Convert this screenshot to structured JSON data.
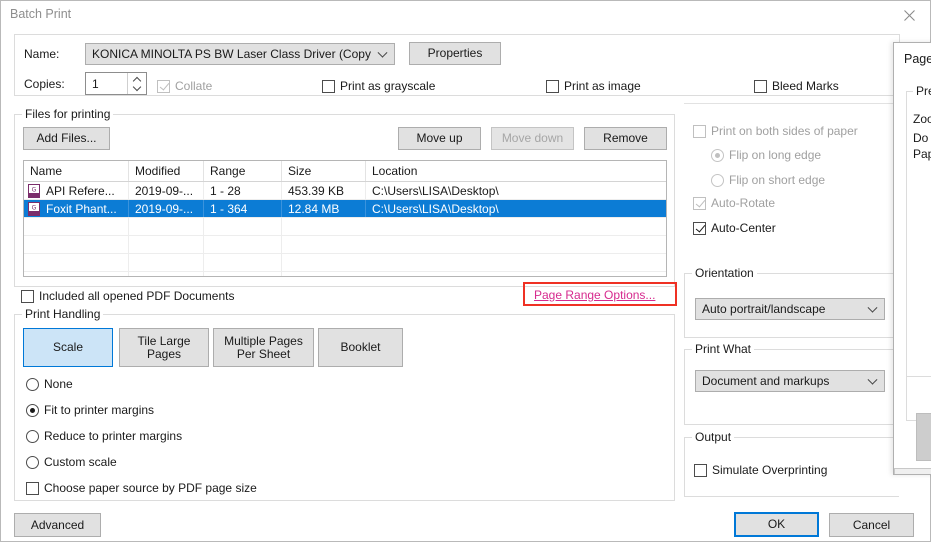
{
  "window": {
    "title": "Batch Print",
    "close_icon": "close-icon"
  },
  "printer": {
    "name_label": "Name:",
    "selected": "KONICA MINOLTA PS BW Laser Class Driver (Copy",
    "properties_label": "Properties",
    "copies_label": "Copies:",
    "copies_value": "1",
    "collate_label": "Collate",
    "collate_checked": true,
    "collate_disabled": true,
    "grayscale_label": "Print as grayscale",
    "grayscale_checked": false,
    "print_as_image_label": "Print as image",
    "print_as_image_checked": false,
    "bleed_marks_label": "Bleed Marks",
    "bleed_marks_checked": false
  },
  "files": {
    "group_label": "Files for printing",
    "add_files_label": "Add Files...",
    "move_up_label": "Move up",
    "move_down_label": "Move down",
    "move_down_disabled": true,
    "remove_label": "Remove",
    "columns": [
      "Name",
      "Modified",
      "Range",
      "Size",
      "Location"
    ],
    "rows": [
      {
        "name": "API Refere...",
        "modified": "2019-09-...",
        "range": "1 - 28",
        "size": "453.39 KB",
        "location": "C:\\Users\\LISA\\Desktop\\",
        "selected": false
      },
      {
        "name": "Foxit Phant...",
        "modified": "2019-09-...",
        "range": "1 - 364",
        "size": "12.84 MB",
        "location": "C:\\Users\\LISA\\Desktop\\",
        "selected": true
      }
    ],
    "empty_rows": 4,
    "include_all_label": "Included all opened PDF Documents",
    "include_all_checked": false,
    "page_range_options_link": "Page Range Options..."
  },
  "print_handling": {
    "group_label": "Print Handling",
    "tabs": [
      {
        "label": "Scale",
        "active": true
      },
      {
        "label": "Tile Large\nPages",
        "active": false
      },
      {
        "label": "Multiple Pages\nPer Sheet",
        "active": false
      },
      {
        "label": "Booklet",
        "active": false
      }
    ],
    "scale_options": [
      {
        "label": "None",
        "selected": false
      },
      {
        "label": "Fit to printer margins",
        "selected": true
      },
      {
        "label": "Reduce to printer margins",
        "selected": false
      },
      {
        "label": "Custom scale",
        "selected": false
      }
    ],
    "paper_source_label": "Choose paper source by PDF page size",
    "paper_source_checked": false
  },
  "right_panel": {
    "duplex_label": "Print on both sides of paper",
    "duplex_checked": false,
    "duplex_disabled": true,
    "flip_long_label": "Flip on long edge",
    "flip_long_selected": true,
    "flip_short_label": "Flip on short edge",
    "flip_short_selected": false,
    "auto_rotate_label": "Auto-Rotate",
    "auto_rotate_checked": true,
    "auto_rotate_disabled": true,
    "auto_center_label": "Auto-Center",
    "auto_center_checked": true,
    "orientation_group": "Orientation",
    "orientation_value": "Auto portrait/landscape",
    "print_what_group": "Print What",
    "print_what_value": "Document and markups",
    "output_group": "Output",
    "simulate_overprinting_label": "Simulate Overprinting",
    "simulate_overprinting_checked": false
  },
  "footer": {
    "advanced_label": "Advanced",
    "ok_label": "OK",
    "cancel_label": "Cancel"
  },
  "overlay_dialog": {
    "title": "Page ",
    "group_label": "Pre",
    "line1": "Zoo",
    "line2": "Do",
    "line3": "Pap"
  },
  "colors": {
    "accent": "#6b4a78",
    "selection": "#0c7cd5",
    "focus_blue": "#0078d7",
    "tab_active_bg": "#cce4f7",
    "link": "#d62a8e",
    "highlight_box": "#ef3124"
  }
}
